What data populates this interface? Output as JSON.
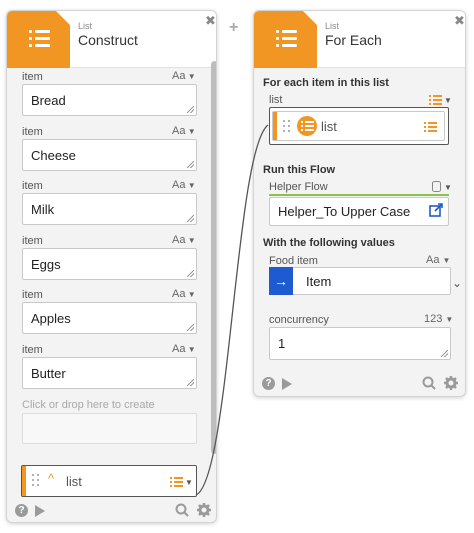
{
  "construct": {
    "type_label": "List",
    "title": "Construct",
    "close_glyph": "✖",
    "item_label": "item",
    "type_tag": "Aa",
    "items": [
      "Bread",
      "Cheese",
      "Milk",
      "Eggs",
      "Apples",
      "Butter"
    ],
    "placeholder": "Click or drop here to create",
    "output_chip": "list"
  },
  "foreach": {
    "type_label": "List",
    "title": "For Each",
    "close_glyph": "✖",
    "section_for_each": "For each item in this list",
    "list_label": "list",
    "list_chip": "list",
    "section_run": "Run this Flow",
    "helper_label": "Helper Flow",
    "helper_value": "Helper_To Upper Case",
    "section_values": "With the following values",
    "food_label": "Food item",
    "food_type": "Aa",
    "food_value": "Item",
    "concurrency_label": "concurrency",
    "concurrency_type": "123",
    "concurrency_value": "1"
  },
  "connector": {
    "plus": "+"
  },
  "icons": {
    "help": "question-circle-icon",
    "run": "play-icon",
    "search": "search-icon",
    "settings": "gear-icon"
  },
  "colors": {
    "accent": "#f29623",
    "link_blue": "#1e5bd0",
    "status_green": "#8bc34a"
  }
}
